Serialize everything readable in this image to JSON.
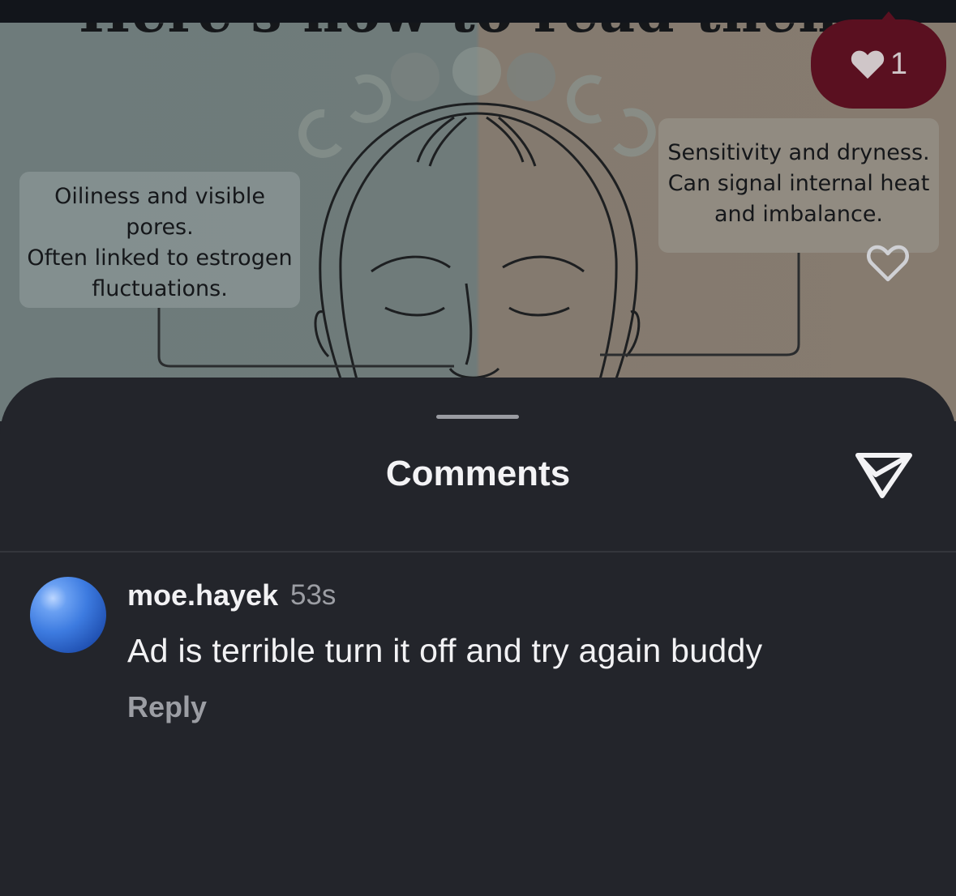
{
  "post": {
    "headline": "Here's how to read them.",
    "caption_left": [
      "Oiliness and visible",
      "pores.",
      "Often linked to estrogen",
      "fluctuations."
    ],
    "caption_right": [
      "Sensitivity and dryness.",
      "Can signal internal heat",
      "and imbalance."
    ],
    "like_count": "1",
    "like_icon": "heart-icon"
  },
  "sheet": {
    "title": "Comments",
    "share_icon": "send-icon"
  },
  "comments": [
    {
      "username": "moe.hayek",
      "time": "53s",
      "text": "Ad is terrible turn it off and try again buddy",
      "reply_label": "Reply",
      "like_icon": "heart-outline-icon"
    }
  ],
  "colors": {
    "sheet_bg": "#23252b",
    "like_badge": "#5a1020",
    "secondary_text": "#9c9ea4"
  }
}
